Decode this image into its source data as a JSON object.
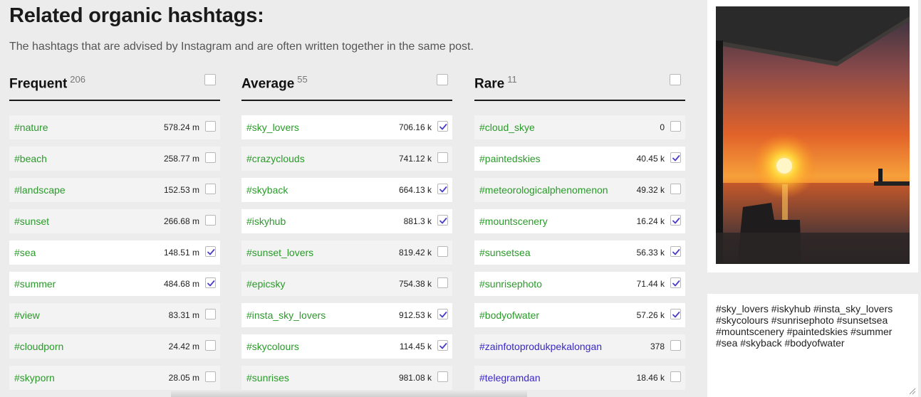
{
  "header": {
    "title": "Related organic hashtags:",
    "subtitle": "The hashtags that are advised by Instagram and are often written together in the same post."
  },
  "colors": {
    "tag_green": "#2a9a2a",
    "tag_blue": "#3a28c8",
    "check_accent": "#4a3ec8"
  },
  "columns": [
    {
      "title": "Frequent",
      "count": "206",
      "rows": [
        {
          "tag": "#nature",
          "count": "578.24 m",
          "checked": false
        },
        {
          "tag": "#beach",
          "count": "258.77 m",
          "checked": false
        },
        {
          "tag": "#landscape",
          "count": "152.53 m",
          "checked": false
        },
        {
          "tag": "#sunset",
          "count": "266.68 m",
          "checked": false
        },
        {
          "tag": "#sea",
          "count": "148.51 m",
          "checked": true
        },
        {
          "tag": "#summer",
          "count": "484.68 m",
          "checked": true
        },
        {
          "tag": "#view",
          "count": "83.31 m",
          "checked": false
        },
        {
          "tag": "#cloudporn",
          "count": "24.42 m",
          "checked": false
        },
        {
          "tag": "#skyporn",
          "count": "28.05 m",
          "checked": false
        }
      ]
    },
    {
      "title": "Average",
      "count": "55",
      "rows": [
        {
          "tag": "#sky_lovers",
          "count": "706.16 k",
          "checked": true
        },
        {
          "tag": "#crazyclouds",
          "count": "741.12 k",
          "checked": false
        },
        {
          "tag": "#skyback",
          "count": "664.13 k",
          "checked": true
        },
        {
          "tag": "#iskyhub",
          "count": "881.3 k",
          "checked": true
        },
        {
          "tag": "#sunset_lovers",
          "count": "819.42 k",
          "checked": false
        },
        {
          "tag": "#epicsky",
          "count": "754.38 k",
          "checked": false
        },
        {
          "tag": "#insta_sky_lovers",
          "count": "912.53 k",
          "checked": true
        },
        {
          "tag": "#skycolours",
          "count": "114.45 k",
          "checked": true
        },
        {
          "tag": "#sunrises",
          "count": "981.08 k",
          "checked": false
        }
      ]
    },
    {
      "title": "Rare",
      "count": "11",
      "rows": [
        {
          "tag": "#cloud_skye",
          "count": "0",
          "checked": false
        },
        {
          "tag": "#paintedskies",
          "count": "40.45 k",
          "checked": true
        },
        {
          "tag": "#meteorologicalphenomenon",
          "count": "49.32 k",
          "checked": false
        },
        {
          "tag": "#mountscenery",
          "count": "16.24 k",
          "checked": true
        },
        {
          "tag": "#sunsetsea",
          "count": "56.33 k",
          "checked": true
        },
        {
          "tag": "#sunrisephoto",
          "count": "71.44 k",
          "checked": true
        },
        {
          "tag": "#bodyofwater",
          "count": "57.26 k",
          "checked": true
        },
        {
          "tag": "#zainfotoprodukpekalongan",
          "count": "378",
          "checked": false,
          "tag_color": "blue"
        },
        {
          "tag": "#telegramdan",
          "count": "18.46 k",
          "checked": false,
          "tag_color": "blue"
        }
      ]
    }
  ],
  "selected_text": "#sky_lovers #iskyhub #insta_sky_lovers #skycolours #sunrisephoto #sunsetsea #mountscenery #paintedskies #summer #sea #skyback #bodyofwater"
}
